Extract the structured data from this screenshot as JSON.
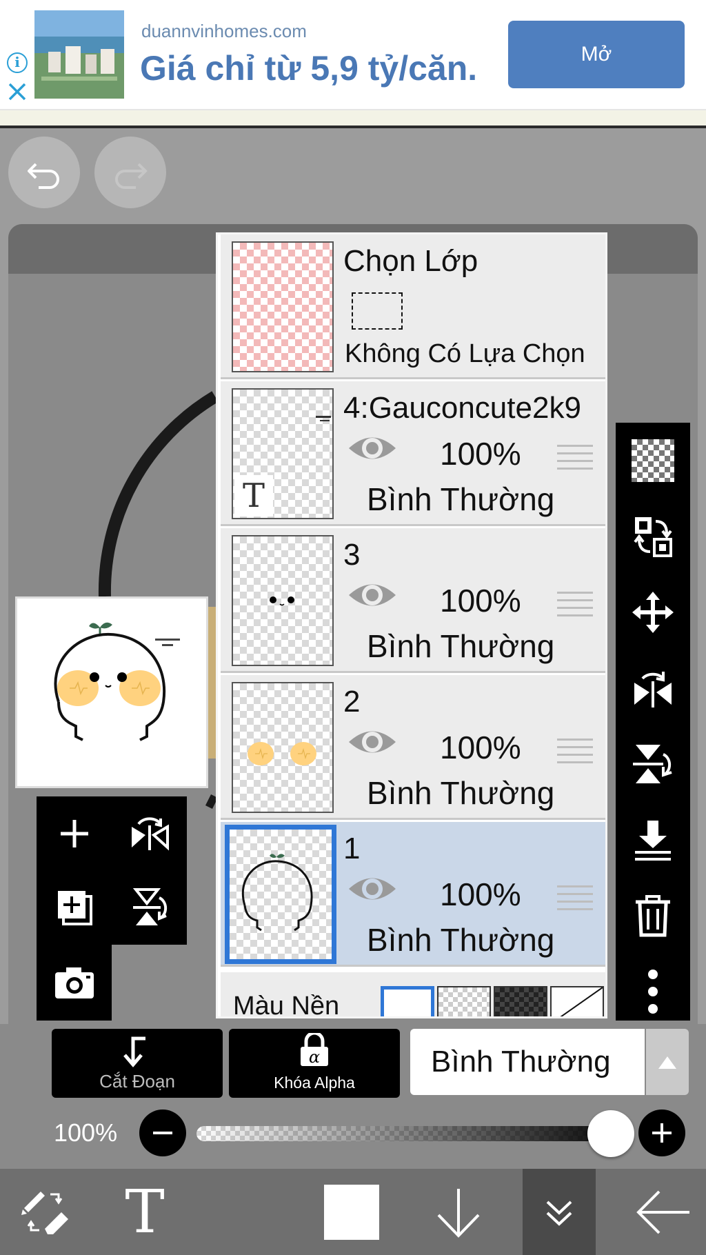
{
  "ad": {
    "domain": "duannvinhomes.com",
    "headline": "Giá chỉ từ 5,9 tỷ/căn.",
    "open_button": "Mở",
    "info_icon": "i"
  },
  "toolbar_top": {
    "undo_icon": "undo-icon",
    "redo_icon": "redo-icon"
  },
  "layers": {
    "selection": {
      "title": "Chọn Lớp",
      "status": "Không Có Lựa Chọn"
    },
    "items": [
      {
        "name": "4:Gauconcute2k9",
        "opacity": "100%",
        "blend": "Bình Thường",
        "type": "text",
        "selected": false
      },
      {
        "name": "3",
        "opacity": "100%",
        "blend": "Bình Thường",
        "type": "face",
        "selected": false
      },
      {
        "name": "2",
        "opacity": "100%",
        "blend": "Bình Thường",
        "type": "cheeks",
        "selected": false
      },
      {
        "name": "1",
        "opacity": "100%",
        "blend": "Bình Thường",
        "type": "outline",
        "selected": true
      }
    ],
    "background_label": "Màu Nền",
    "text_layer_glyph": "T"
  },
  "bottom_controls": {
    "clipping_label": "Cắt Đoạn",
    "alpha_lock_label": "Khóa Alpha",
    "blend_mode": "Bình Thường",
    "opacity_label": "100%",
    "opacity_value": 1.0
  },
  "nav": {
    "text_tool_glyph": "T"
  },
  "colors": {
    "accent_blue": "#2f77d6",
    "selected_row": "#cad7e8",
    "ad_button": "#4f7fbf",
    "cheek_yellow": "#ffd27f"
  }
}
